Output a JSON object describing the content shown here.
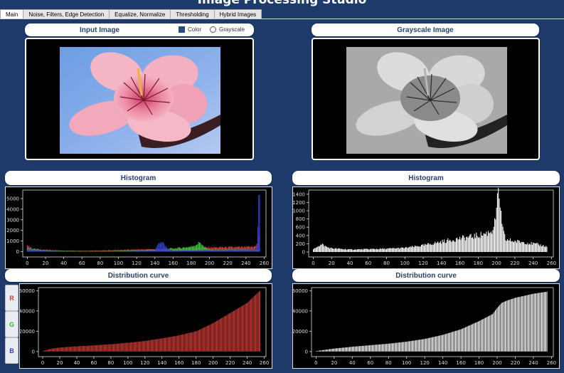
{
  "app": {
    "title": "Image Processing Studio"
  },
  "tabs": [
    "Main",
    "Noise, Filters, Edge Detection",
    "Equalize, Normalize",
    "Thresholding",
    "Hybrid Images"
  ],
  "input_panel": {
    "title": "Input Image",
    "options": [
      "Color",
      "Grayscale"
    ],
    "selected": "Color"
  },
  "gray_panel": {
    "title": "Grayscale Image"
  },
  "left_hist": {
    "title": "Histogram"
  },
  "right_hist": {
    "title": "Histogram"
  },
  "left_dist": {
    "title": "Distribution curve"
  },
  "right_dist": {
    "title": "Distribution curve"
  },
  "channels": [
    "R",
    "G",
    "B"
  ],
  "colors": {
    "background": "#1e3a6b",
    "red": "#d9403a",
    "green": "#36c23a",
    "blue": "#3240d8",
    "pill_text": "#2b3f6e"
  },
  "chart_data": [
    {
      "type": "bar",
      "name": "Color histogram",
      "x_ticks": [
        0,
        20,
        40,
        60,
        80,
        100,
        120,
        140,
        160,
        180,
        200,
        220,
        240,
        260
      ],
      "y_ticks": [
        0,
        1000,
        2000,
        3000,
        4000,
        5000
      ],
      "xlim": [
        -5,
        262
      ],
      "ylim": [
        -500,
        5800
      ],
      "series": [
        {
          "name": "R",
          "x": [
            0,
            3,
            6,
            10,
            20,
            40,
            60,
            80,
            100,
            120,
            140,
            160,
            180,
            190,
            200,
            220,
            240,
            248,
            252,
            254,
            255
          ],
          "values": [
            700,
            420,
            300,
            250,
            180,
            100,
            90,
            110,
            160,
            210,
            250,
            300,
            360,
            420,
            400,
            420,
            430,
            450,
            700,
            1500,
            1800
          ]
        },
        {
          "name": "G",
          "x": [
            0,
            10,
            20,
            40,
            60,
            80,
            100,
            120,
            140,
            150,
            160,
            170,
            180,
            185,
            188,
            190,
            192,
            195,
            200
          ],
          "values": [
            350,
            220,
            120,
            80,
            60,
            60,
            70,
            120,
            200,
            250,
            300,
            380,
            480,
            650,
            800,
            900,
            650,
            350,
            200
          ]
        },
        {
          "name": "B",
          "x": [
            0,
            10,
            20,
            40,
            100,
            140,
            142,
            145,
            148,
            150,
            155,
            160,
            250,
            252,
            253,
            254,
            255
          ],
          "values": [
            250,
            150,
            80,
            40,
            30,
            120,
            500,
            850,
            950,
            650,
            200,
            100,
            200,
            600,
            2200,
            5500,
            4800
          ]
        }
      ]
    },
    {
      "type": "bar",
      "name": "Grayscale histogram",
      "x_ticks": [
        0,
        20,
        40,
        60,
        80,
        100,
        120,
        140,
        160,
        180,
        200,
        220,
        240,
        260
      ],
      "y_ticks": [
        0,
        200,
        400,
        600,
        800,
        1000,
        1200,
        1400
      ],
      "xlim": [
        -5,
        262
      ],
      "ylim": [
        -120,
        1500
      ],
      "series": [
        {
          "name": "Gray",
          "x": [
            0,
            5,
            10,
            15,
            20,
            40,
            60,
            80,
            100,
            120,
            140,
            160,
            170,
            180,
            190,
            195,
            198,
            200,
            202,
            204,
            206,
            210,
            220,
            230,
            240,
            250,
            255
          ],
          "values": [
            60,
            150,
            180,
            120,
            90,
            60,
            70,
            80,
            100,
            160,
            250,
            330,
            360,
            400,
            460,
            520,
            700,
            1000,
            1380,
            1200,
            600,
            300,
            260,
            240,
            200,
            160,
            130
          ]
        }
      ]
    },
    {
      "type": "bar",
      "name": "Color distribution curve",
      "x_ticks": [
        0,
        20,
        40,
        60,
        80,
        100,
        120,
        140,
        160,
        180,
        200,
        220,
        240,
        260
      ],
      "y_ticks": [
        0,
        20000,
        40000,
        60000
      ],
      "xlim": [
        -5,
        262
      ],
      "ylim": [
        -5000,
        63000
      ],
      "series": [
        {
          "name": "R",
          "x": [
            0,
            10,
            20,
            40,
            60,
            80,
            100,
            120,
            140,
            160,
            180,
            200,
            220,
            240,
            255
          ],
          "values": [
            500,
            2800,
            4000,
            5200,
            6200,
            7300,
            8700,
            10500,
            13000,
            16000,
            20000,
            28000,
            38000,
            48000,
            60000
          ]
        }
      ]
    },
    {
      "type": "bar",
      "name": "Grayscale distribution curve",
      "x_ticks": [
        0,
        20,
        40,
        60,
        80,
        100,
        120,
        140,
        160,
        180,
        200,
        220,
        240,
        260
      ],
      "y_ticks": [
        0,
        20000,
        40000,
        60000
      ],
      "xlim": [
        -5,
        262
      ],
      "ylim": [
        -5000,
        63000
      ],
      "series": [
        {
          "name": "Gray",
          "x": [
            0,
            10,
            20,
            40,
            60,
            80,
            100,
            120,
            140,
            160,
            180,
            195,
            200,
            205,
            210,
            220,
            240,
            255
          ],
          "values": [
            500,
            1800,
            3000,
            4800,
            6300,
            7800,
            9800,
            12500,
            16500,
            22000,
            30000,
            37000,
            43000,
            48000,
            50000,
            53000,
            57000,
            59000
          ]
        }
      ]
    }
  ]
}
